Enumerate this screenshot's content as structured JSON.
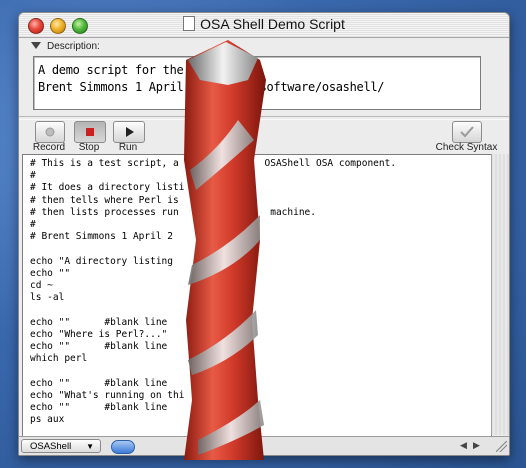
{
  "window": {
    "title": "OSA Shell Demo Script"
  },
  "description": {
    "label": "Description:",
    "lines": [
      "A demo script for the                    component.",
      "Brent Simmons 1 April        chero.com/software/osashell/"
    ]
  },
  "toolbar": {
    "record_label": "Record",
    "stop_label": "Stop",
    "run_label": "Run",
    "check_syntax_label": "Check Syntax"
  },
  "script": {
    "lines": [
      "# This is a test script, a               OSAShell OSA component.",
      "#",
      "# It does a directory listi",
      "# then tells where Perl is",
      "# then lists processes run                machine.",
      "#",
      "# Brent Simmons 1 April 2",
      "",
      "echo \"A directory listing",
      "echo \"\"",
      "cd ~",
      "ls -al",
      "",
      "echo \"\"      #blank line",
      "echo \"Where is Perl?...\"",
      "echo \"\"      #blank line",
      "which perl",
      "",
      "echo \"\"      #blank line",
      "echo \"What's running on thi",
      "echo \"\"      #blank line",
      "ps aux"
    ]
  },
  "language_popup": {
    "value": "OSAShell"
  },
  "icons": {
    "close": "close-icon",
    "minimize": "minimize-icon",
    "zoom": "zoom-icon",
    "record": "record-icon",
    "stop": "stop-icon",
    "run": "play-icon",
    "check_syntax": "checkmark-icon"
  },
  "colors": {
    "desktop": "#3e6db0",
    "drill_red": "#d13a2a",
    "stop_red": "#cc2020"
  }
}
